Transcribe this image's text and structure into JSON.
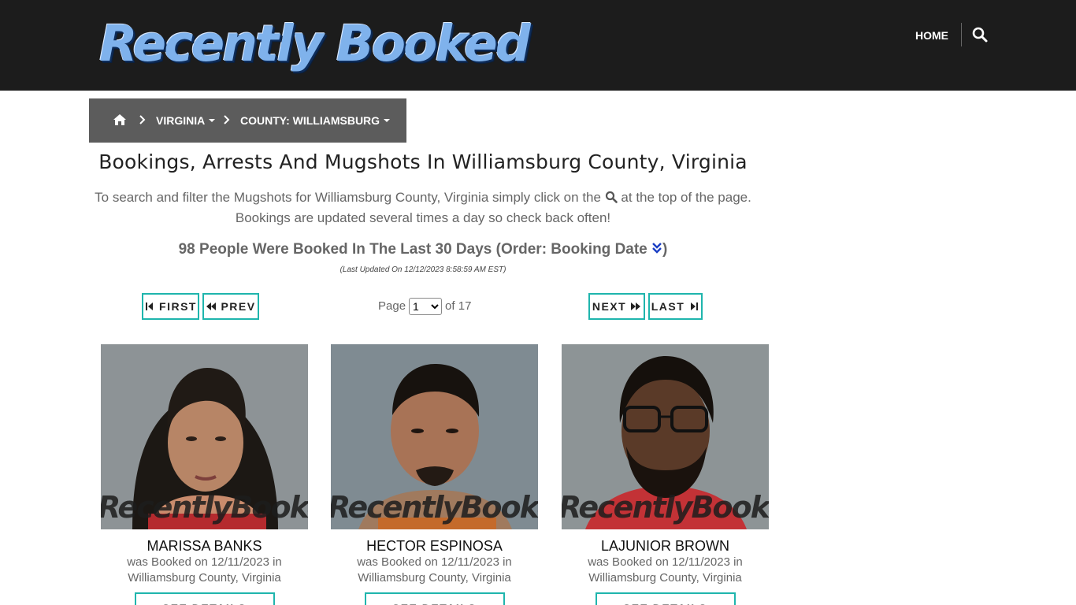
{
  "header": {
    "logo_text": "Recently Booked",
    "nav_home": "HOME"
  },
  "breadcrumb": {
    "items": [
      {
        "label": "VIRGINIA"
      },
      {
        "label": "COUNTY: WILLIAMSBURG"
      }
    ]
  },
  "page": {
    "title": "Bookings, Arrests And Mugshots In Williamsburg County, Virginia",
    "intro_part1": "To search and filter the Mugshots for Williamsburg County, Virginia simply click on the",
    "intro_part2": "at the top of the page.",
    "intro_line2": "Bookings are updated several times a day so check back often!",
    "count_text": "98 People Were Booked In The Last 30 Days (Order: Booking Date",
    "count_close": ")",
    "updated": "(Last Updated On 12/12/2023 8:58:59 AM EST)"
  },
  "pagination": {
    "first": "FIRST",
    "prev": "PREV",
    "next": "NEXT",
    "last": "LAST",
    "page_label": "Page",
    "current_page": "1",
    "of_label": "of 17"
  },
  "cards": [
    {
      "name": "MARISSA BANKS",
      "desc": "was Booked on 12/11/2023 in Williamsburg County, Virginia",
      "watermark": "RecentlyBooked.com",
      "button": "SEE DETAILS"
    },
    {
      "name": "HECTOR ESPINOSA",
      "desc": "was Booked on 12/11/2023 in Williamsburg County, Virginia",
      "watermark": "RecentlyBooked.com",
      "button": "SEE DETAILS"
    },
    {
      "name": "LAJUNIOR BROWN",
      "desc": "was Booked on 12/11/2023 in Williamsburg County, Virginia",
      "watermark": "RecentlyBooked.com",
      "button": "SEE DETAILS"
    }
  ],
  "colors": {
    "header_bg": "#1c1c1c",
    "breadcrumb_bg": "#5c5c5c",
    "accent_teal": "#1fb5ad",
    "logo_blue": "#7fb2ec"
  },
  "icons": {
    "search": "search-icon",
    "home": "home-icon",
    "sort": "double-chevron-down-icon"
  }
}
